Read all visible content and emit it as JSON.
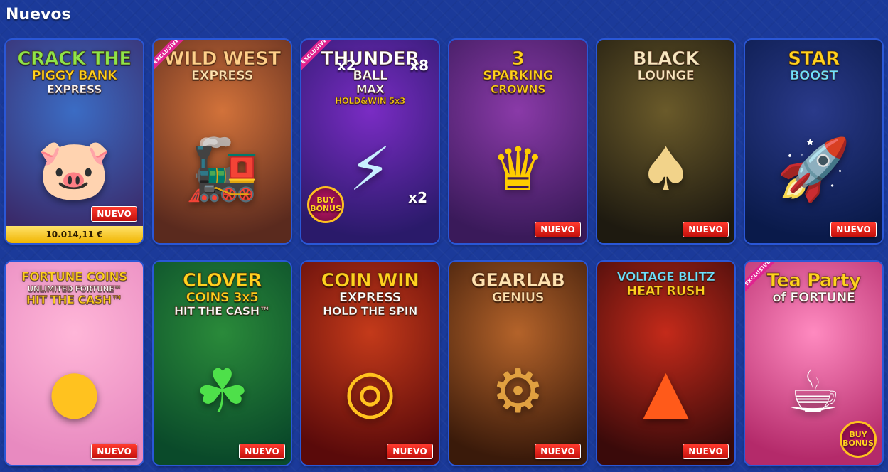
{
  "section": {
    "title": "Nuevos"
  },
  "badge": {
    "nuevo": "NUEVO",
    "exclusive": "EXCLUSIVE"
  },
  "games": [
    {
      "lines": [
        "CRACK THE",
        "PIGGY BANK",
        "EXPRESS"
      ],
      "colors": [
        "#8ee44a",
        "#ffd21f",
        "#ffffff"
      ],
      "bg": [
        "#3b6cc4",
        "#3a2a6a"
      ],
      "exclusive": false,
      "jackpot": "10.014,11 €",
      "nuevo": true,
      "icon": "piggy-bank-icon"
    },
    {
      "lines": [
        "WILD WEST",
        "EXPRESS"
      ],
      "colors": [
        "#ffd08a",
        "#ffe3b0"
      ],
      "bg": [
        "#d2723a",
        "#5a2a1e"
      ],
      "exclusive": true,
      "nuevo": false,
      "icon": "train-icon"
    },
    {
      "lines": [
        "THUNDER",
        "BALL",
        "MAX",
        "HOLD&WIN 5x3"
      ],
      "colors": [
        "#ffffff",
        "#ffffff",
        "#ffffff",
        "#ffd21f"
      ],
      "bg": [
        "#7a2cc4",
        "#2a1a6a"
      ],
      "exclusive": true,
      "nuevo": false,
      "icon": "lightning-ball-icon",
      "extra": [
        "x2",
        "x8",
        "x2",
        "BUY BONUS"
      ]
    },
    {
      "lines": [
        "3",
        "SPARKING",
        "CROWNS"
      ],
      "colors": [
        "#ffd21f",
        "#ffd21f",
        "#ffd21f"
      ],
      "bg": [
        "#8a3aa8",
        "#3a1a5a"
      ],
      "exclusive": false,
      "nuevo": true,
      "icon": "crown-icon"
    },
    {
      "lines": [
        "BLACK",
        "LOUNGE"
      ],
      "colors": [
        "#f7e7c0",
        "#f7e7c0"
      ],
      "bg": [
        "#6a5a2a",
        "#1e1a10"
      ],
      "exclusive": false,
      "nuevo": true,
      "icon": "spade-icon"
    },
    {
      "lines": [
        "STAR",
        "BOOST"
      ],
      "colors": [
        "#ffd21f",
        "#6fe0ff"
      ],
      "bg": [
        "#2a3a8a",
        "#0a1a4a"
      ],
      "exclusive": false,
      "nuevo": true,
      "icon": "rocket-icon"
    },
    {
      "lines": [
        "FORTUNE COINS",
        "UNLIMITED FORTUNE™",
        "HIT THE CASH™"
      ],
      "colors": [
        "#ffd21f",
        "#ffffff",
        "#ffd21f"
      ],
      "bg": [
        "#ffb6d8",
        "#e88ac0"
      ],
      "exclusive": false,
      "nuevo": true,
      "icon": "coin-icon"
    },
    {
      "lines": [
        "CLOVER",
        "COINS 3x5",
        "HIT THE CASH™"
      ],
      "colors": [
        "#ffd21f",
        "#ffd21f",
        "#ffffff"
      ],
      "bg": [
        "#2a8a3a",
        "#0a4a2a"
      ],
      "exclusive": false,
      "nuevo": true,
      "icon": "clover-icon"
    },
    {
      "lines": [
        "COIN WIN",
        "EXPRESS",
        "HOLD THE SPIN"
      ],
      "colors": [
        "#ffd21f",
        "#ffffff",
        "#ffffff"
      ],
      "bg": [
        "#c43a1a",
        "#5a0a0a"
      ],
      "exclusive": false,
      "nuevo": true,
      "icon": "coin-machine-icon"
    },
    {
      "lines": [
        "GEARLAB",
        "GENIUS"
      ],
      "colors": [
        "#ffe3b0",
        "#ffe3b0"
      ],
      "bg": [
        "#b4632a",
        "#3a1a0a"
      ],
      "exclusive": false,
      "nuevo": true,
      "icon": "gear-icon"
    },
    {
      "lines": [
        "VOLTAGE BLITZ",
        "HEAT RUSH"
      ],
      "colors": [
        "#6fe0ff",
        "#ffd21f"
      ],
      "bg": [
        "#c42a1a",
        "#3a0a0a"
      ],
      "exclusive": false,
      "nuevo": true,
      "icon": "volcano-icon"
    },
    {
      "lines": [
        "Tea Party",
        "of FORTUNE"
      ],
      "colors": [
        "#ffd21f",
        "#ffffff"
      ],
      "bg": [
        "#ff8ac0",
        "#b42a6a"
      ],
      "exclusive": true,
      "nuevo": false,
      "icon": "teacup-icon",
      "extra": [
        "BUY BONUS"
      ]
    }
  ]
}
